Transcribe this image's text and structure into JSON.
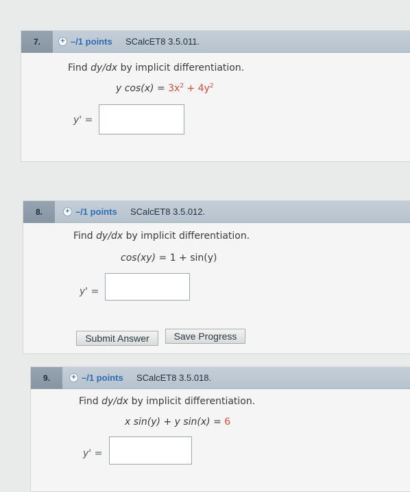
{
  "questions": [
    {
      "number": "7.",
      "points": "–/1 points",
      "source": "SCalcET8 3.5.011.",
      "prompt_prefix": "Find ",
      "prompt_var": "dy/dx",
      "prompt_suffix": " by implicit differentiation.",
      "lhs": "y cos(x) = ",
      "rhs": "3x",
      "rhs_exp": "2",
      "rhs2": " + 4y",
      "rhs2_exp": "2",
      "answer_label": "y' =",
      "answer_value": ""
    },
    {
      "number": "8.",
      "points": "–/1 points",
      "source": "SCalcET8 3.5.012.",
      "prompt_prefix": "Find ",
      "prompt_var": "dy/dx",
      "prompt_suffix": " by implicit differentiation.",
      "lhs": "cos(xy) = ",
      "rhs": "1 + sin(y)",
      "answer_label": "y' =",
      "answer_value": ""
    },
    {
      "number": "9.",
      "points": "–/1 points",
      "source": "SCalcET8 3.5.018.",
      "prompt_prefix": "Find ",
      "prompt_var": "dy/dx",
      "prompt_suffix": " by implicit differentiation.",
      "lhs": "x sin(y) + y sin(x) = ",
      "rhs": "6",
      "answer_label": "y' =",
      "answer_value": ""
    }
  ],
  "buttons": {
    "submit": "Submit Answer",
    "save": "Save Progress"
  },
  "colors": {
    "points": "#2e6db3",
    "header": "#bcc7d2",
    "rhs_red": "#d44a3a"
  }
}
